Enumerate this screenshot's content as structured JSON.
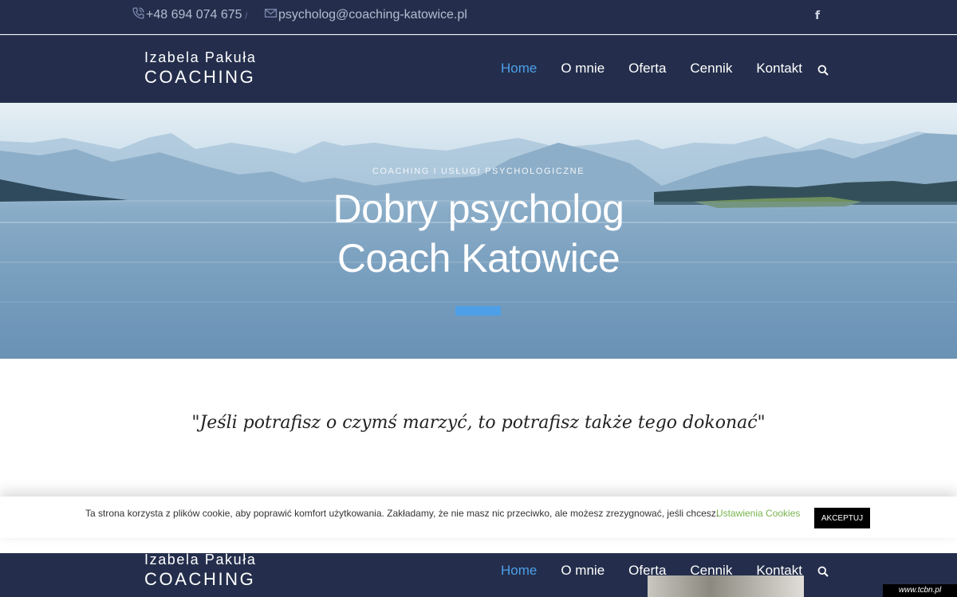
{
  "topbar": {
    "phone": "+48 694 074 675",
    "separator": "/",
    "email": "psycholog@coaching-katowice.pl",
    "social_icon": "f"
  },
  "header": {
    "logo_name": "Izabela Pakuła",
    "logo_brand": "COACHING",
    "nav": [
      {
        "label": "Home",
        "active": true
      },
      {
        "label": "O mnie"
      },
      {
        "label": "Oferta"
      },
      {
        "label": "Cennik"
      },
      {
        "label": "Kontakt"
      }
    ]
  },
  "hero": {
    "subtitle": "COACHING I USŁUGI PSYCHOLOGICZNE",
    "title_line1": "Dobry psycholog",
    "title_line2": "Coach Katowice"
  },
  "quote": "\"Jeśli potrafisz o czymś marzyć, to potrafisz także tego dokonać\"",
  "cookie": {
    "text": "Ta strona korzysta z plików cookie, aby poprawić komfort użytkowania. Zakładamy, że nie masz nic przeciwko, ale możesz zrezygnować, jeśli chcesz.",
    "settings": "Ustawienia Cookies",
    "accept": "AKCEPTUJ"
  },
  "watermark": "www.tcbn.pl",
  "colors": {
    "navy": "#242e4c",
    "accent": "#4d9fe8",
    "cookie_link": "#77b34d"
  }
}
